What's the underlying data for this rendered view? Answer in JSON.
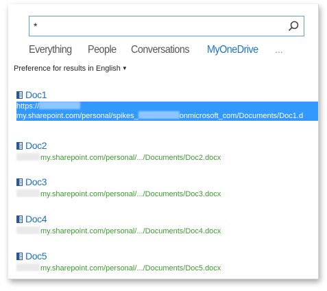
{
  "search": {
    "value": "*"
  },
  "tabs": [
    {
      "label": "Everything",
      "active": false
    },
    {
      "label": "People",
      "active": false
    },
    {
      "label": "Conversations",
      "active": false
    },
    {
      "label": "MyOneDrive",
      "active": true
    }
  ],
  "tabs_more": "...",
  "preference": {
    "label": "Preference for results in English"
  },
  "results": [
    {
      "title": "Doc1",
      "url_line1": "https://",
      "url_line2_a": "my.sharepoint.com/personal/spikes_",
      "url_line2_b": "onmicrosoft_com/Documents/Doc1.d"
    },
    {
      "title": "Doc2",
      "url": "my.sharepoint.com/personal/.../Documents/Doc2.docx"
    },
    {
      "title": "Doc3",
      "url": "my.sharepoint.com/personal/.../Documents/Doc3.docx"
    },
    {
      "title": "Doc4",
      "url": "my.sharepoint.com/personal/.../Documents/Doc4.docx"
    },
    {
      "title": "Doc5",
      "url": "my.sharepoint.com/personal/.../Documents/Doc5.docx"
    }
  ],
  "colors": {
    "accent": "#1f73c3",
    "link": "#1f6fc0",
    "url_green": "#3d9a2f",
    "selection": "#3399ff",
    "search_border": "#5ea3d7"
  },
  "icons": {
    "search": "search-icon",
    "document": "word-document-icon",
    "dropdown": "caret-down-icon"
  }
}
